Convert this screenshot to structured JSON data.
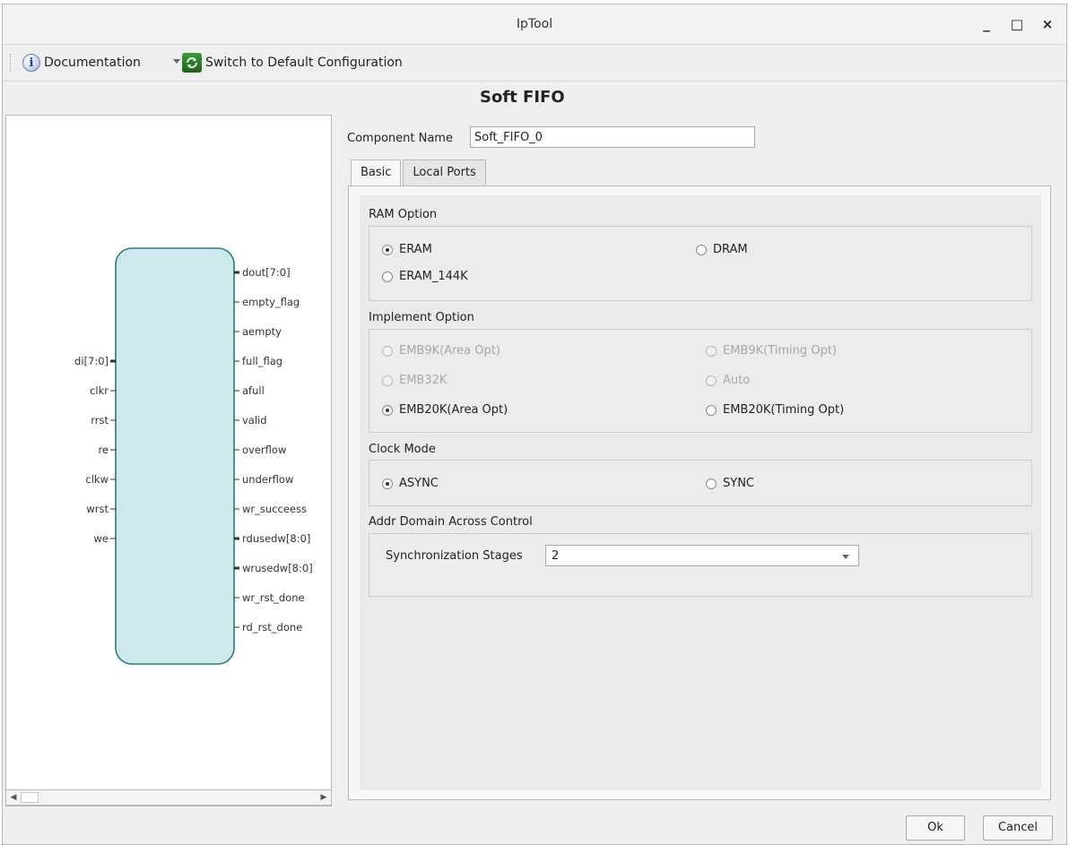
{
  "window": {
    "title": "IpTool",
    "minimize": "_",
    "maximize": "□",
    "close": "×"
  },
  "toolbar": {
    "documentation": "Documentation",
    "switch_default": "Switch to Default Configuration"
  },
  "page": {
    "title": "Soft FIFO"
  },
  "component": {
    "label": "Component Name",
    "value": "Soft_FIFO_0"
  },
  "tabs": [
    {
      "label": "Basic",
      "active": true
    },
    {
      "label": "Local Ports",
      "active": false
    }
  ],
  "ram_option": {
    "label": "RAM Option",
    "options": [
      {
        "label": "ERAM",
        "checked": true
      },
      {
        "label": "DRAM",
        "checked": false
      },
      {
        "label": "ERAM_144K",
        "checked": false
      }
    ]
  },
  "implement_option": {
    "label": "Implement Option",
    "options": [
      {
        "label": "EMB9K(Area Opt)",
        "checked": false,
        "disabled": true
      },
      {
        "label": "EMB9K(Timing Opt)",
        "checked": false,
        "disabled": true
      },
      {
        "label": "EMB32K",
        "checked": false,
        "disabled": true
      },
      {
        "label": "Auto",
        "checked": false,
        "disabled": true
      },
      {
        "label": "EMB20K(Area Opt)",
        "checked": true,
        "disabled": false
      },
      {
        "label": "EMB20K(Timing Opt)",
        "checked": false,
        "disabled": false
      }
    ]
  },
  "clock_mode": {
    "label": "Clock Mode",
    "options": [
      {
        "label": "ASYNC",
        "checked": true
      },
      {
        "label": "SYNC",
        "checked": false
      }
    ]
  },
  "addr_domain": {
    "label": "Addr Domain Across Control",
    "sync_label": "Synchronization Stages",
    "sync_value": "2"
  },
  "diagram": {
    "inputs": [
      {
        "name": "di[7:0]",
        "bus": true
      },
      {
        "name": "clkr",
        "bus": false
      },
      {
        "name": "rrst",
        "bus": false
      },
      {
        "name": "re",
        "bus": false
      },
      {
        "name": "clkw",
        "bus": false
      },
      {
        "name": "wrst",
        "bus": false
      },
      {
        "name": "we",
        "bus": false
      }
    ],
    "outputs": [
      {
        "name": "dout[7:0]",
        "bus": true
      },
      {
        "name": "empty_flag",
        "bus": false
      },
      {
        "name": "aempty",
        "bus": false
      },
      {
        "name": "full_flag",
        "bus": false
      },
      {
        "name": "afull",
        "bus": false
      },
      {
        "name": "valid",
        "bus": false
      },
      {
        "name": "overflow",
        "bus": false
      },
      {
        "name": "underflow",
        "bus": false
      },
      {
        "name": "wr_succeess",
        "bus": false
      },
      {
        "name": "rdusedw[8:0]",
        "bus": true
      },
      {
        "name": "wrusedw[8:0]",
        "bus": true
      },
      {
        "name": "wr_rst_done",
        "bus": false
      },
      {
        "name": "rd_rst_done",
        "bus": false
      }
    ]
  },
  "buttons": {
    "ok": "Ok",
    "cancel": "Cancel"
  },
  "colors": {
    "block_fill": "#cde9ec",
    "block_stroke": "#2e7b7f",
    "switch_icon": "#2f8a2c"
  },
  "icons": {
    "documentation": "info-icon",
    "switch": "refresh-icon"
  }
}
